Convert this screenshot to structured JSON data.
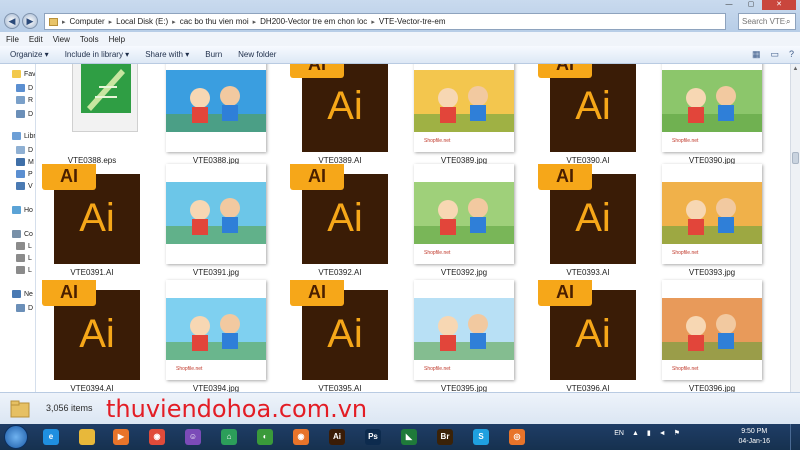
{
  "window": {
    "controls": [
      "—",
      "▢",
      "✕"
    ]
  },
  "address": {
    "crumbs": [
      "Computer",
      "Local Disk (E:)",
      "cac bo thu vien moi",
      "DH200-Vector tre em chon loc",
      "VTE-Vector-tre-em"
    ],
    "search_placeholder": "Search VTE-..."
  },
  "menu": [
    "File",
    "Edit",
    "View",
    "Tools",
    "Help"
  ],
  "toolbar": {
    "organize": "Organize ▾",
    "include": "Include in library ▾",
    "share": "Share with ▾",
    "burn": "Burn",
    "newfolder": "New folder"
  },
  "nav": [
    {
      "label": "Fav",
      "color": "#f2c94c"
    },
    {
      "label": "D",
      "color": "#5b8fd1"
    },
    {
      "label": "R",
      "color": "#7aa0c9"
    },
    {
      "label": "D",
      "color": "#6b8fb8"
    },
    {
      "label": "Libr",
      "color": "#6d9fd6"
    },
    {
      "label": "D",
      "color": "#8fb0d3"
    },
    {
      "label": "M",
      "color": "#3f6fa8"
    },
    {
      "label": "P",
      "color": "#5b8fd1"
    },
    {
      "label": "V",
      "color": "#4a7ab3"
    },
    {
      "label": "Ho",
      "color": "#5ba3d6"
    },
    {
      "label": "Co",
      "color": "#7890a8"
    },
    {
      "label": "L",
      "color": "#8b8b8b"
    },
    {
      "label": "L",
      "color": "#8b8b8b"
    },
    {
      "label": "L",
      "color": "#8b8b8b"
    },
    {
      "label": "Ne",
      "color": "#4a7ab3"
    },
    {
      "label": "D",
      "color": "#6b8fb8"
    }
  ],
  "files": [
    {
      "name": "VTE0388.eps",
      "kind": "eps"
    },
    {
      "name": "VTE0388.jpg",
      "kind": "jpg",
      "art": "#3a9ee0"
    },
    {
      "name": "VTE0389.AI",
      "kind": "ai"
    },
    {
      "name": "VTE0389.jpg",
      "kind": "jpg",
      "art": "#f3c64e",
      "wm": "Shopfile.net"
    },
    {
      "name": "VTE0390.AI",
      "kind": "ai"
    },
    {
      "name": "VTE0390.jpg",
      "kind": "jpg",
      "art": "#8cc66b",
      "wm": "Shopfile.net"
    },
    {
      "name": "VTE0391.AI",
      "kind": "ai"
    },
    {
      "name": "VTE0391.jpg",
      "kind": "jpg",
      "art": "#6cc6e8"
    },
    {
      "name": "VTE0392.AI",
      "kind": "ai"
    },
    {
      "name": "VTE0392.jpg",
      "kind": "jpg",
      "art": "#9fd07a",
      "wm": "Shopfile.net"
    },
    {
      "name": "VTE0393.AI",
      "kind": "ai"
    },
    {
      "name": "VTE0393.jpg",
      "kind": "jpg",
      "art": "#f0b14a",
      "wm": "Shopfile.net"
    },
    {
      "name": "VTE0394.AI",
      "kind": "ai"
    },
    {
      "name": "VTE0394.jpg",
      "kind": "jpg",
      "art": "#7fd0f0",
      "wm": "Shopfile.net"
    },
    {
      "name": "VTE0395.AI",
      "kind": "ai"
    },
    {
      "name": "VTE0395.jpg",
      "kind": "jpg",
      "art": "#b8e0f5",
      "wm": "Shopfile.net"
    },
    {
      "name": "VTE0396.AI",
      "kind": "ai"
    },
    {
      "name": "VTE0396.jpg",
      "kind": "jpg",
      "art": "#e89a5a",
      "wm": "Shopfile.net"
    }
  ],
  "ai_icon": {
    "tab": "AI",
    "big": "Ai"
  },
  "status": {
    "count": "3,056 items",
    "watermark": "thuviendohoa.com.vn"
  },
  "taskbar": {
    "apps": [
      {
        "name": "ie-icon",
        "color": "#1f8fe0",
        "glyph": "e"
      },
      {
        "name": "explorer-icon",
        "color": "#e8b83a",
        "glyph": ""
      },
      {
        "name": "media-player-icon",
        "color": "#e8742a",
        "glyph": "▶"
      },
      {
        "name": "chrome-icon",
        "color": "#e04b3a",
        "glyph": "◉"
      },
      {
        "name": "yahoo-messenger-icon",
        "color": "#7b4bb8",
        "glyph": "☺"
      },
      {
        "name": "mobile-app-icon",
        "color": "#2c9e5a",
        "glyph": "⌂"
      },
      {
        "name": "coreldraw-icon",
        "color": "#3a9a3a",
        "glyph": "◐"
      },
      {
        "name": "firefox-icon",
        "color": "#e8742a",
        "glyph": "◉"
      },
      {
        "name": "illustrator-icon",
        "color": "#3a1c06",
        "glyph": "Ai"
      },
      {
        "name": "photoshop-icon",
        "color": "#0d2b4e",
        "glyph": "Ps"
      },
      {
        "name": "corel-icon",
        "color": "#1f7a3a",
        "glyph": "◣"
      },
      {
        "name": "bridge-icon",
        "color": "#3a2208",
        "glyph": "Br"
      },
      {
        "name": "skype-icon",
        "color": "#1fa0e0",
        "glyph": "S"
      },
      {
        "name": "unikey-icon",
        "color": "#e8742a",
        "glyph": "◎"
      }
    ],
    "lang": "EN",
    "time": "9:50 PM",
    "date": "04-Jan-16"
  }
}
